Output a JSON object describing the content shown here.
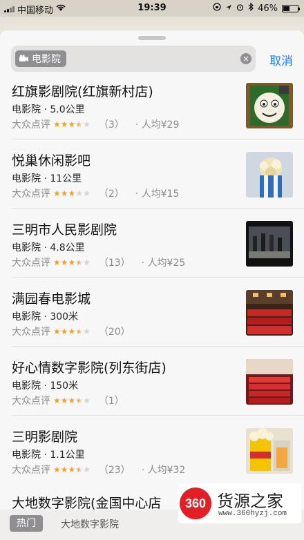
{
  "status_bar": {
    "carrier": "中国移动",
    "time": "19:39",
    "battery_percent": "46%",
    "battery_level": 0.46
  },
  "search": {
    "token_label": "电影院",
    "token_icon": "film-camera-icon",
    "clear_icon": "clear-circle-icon",
    "cancel_label": "取消"
  },
  "results": [
    {
      "name": "红旗影剧院(红旗新村店)",
      "category": "电影院",
      "distance": "5.0公里",
      "source": "大众点评",
      "rating": 3.5,
      "reviews": "（3）",
      "avg_price": "· 人均¥29"
    },
    {
      "name": "悦巢休闲影吧",
      "category": "电影院",
      "distance": "11公里",
      "source": "大众点评",
      "rating": 3,
      "reviews": "（2）",
      "avg_price": "· 人均¥15"
    },
    {
      "name": "三明市人民影剧院",
      "category": "电影院",
      "distance": "4.8公里",
      "source": "大众点评",
      "rating": 3.5,
      "reviews": "（13）",
      "avg_price": "· 人均¥25"
    },
    {
      "name": "满园春电影城",
      "category": "电影院",
      "distance": "300米",
      "source": "大众点评",
      "rating": 3.5,
      "reviews": "（20）",
      "avg_price": ""
    },
    {
      "name": "好心情数字影院(列东街店)",
      "category": "电影院",
      "distance": "150米",
      "source": "大众点评",
      "rating": 3.5,
      "reviews": "（1）",
      "avg_price": ""
    },
    {
      "name": "三明影剧院",
      "category": "电影院",
      "distance": "1.1公里",
      "source": "大众点评",
      "rating": 3.5,
      "reviews": "（23）",
      "avg_price": "· 人均¥32"
    }
  ],
  "partial_result_name": "大地数字影院(金国中心店",
  "bottom": {
    "hot_label": "热门",
    "hot_item": "大地数字影院"
  },
  "watermark": {
    "logo": "360",
    "name": "货源之家",
    "url": "www.360hyzj.com"
  },
  "colors": {
    "accent": "#1a7cf2",
    "star": "#f0a12c",
    "token_bg": "#8e8e93"
  }
}
